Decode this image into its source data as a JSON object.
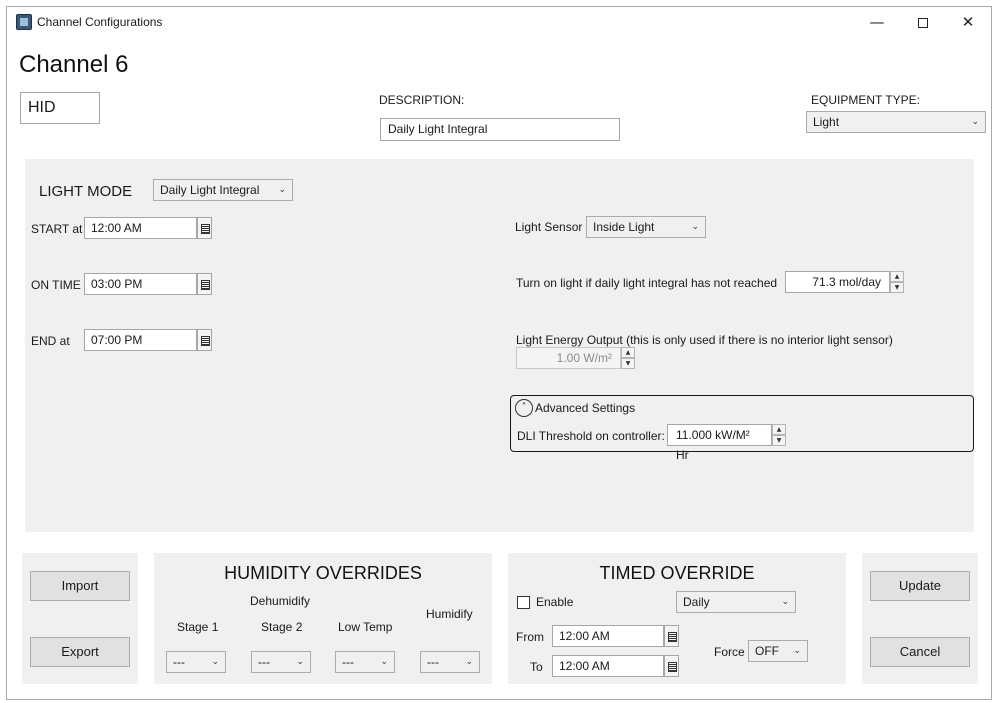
{
  "window": {
    "title": "Channel Configurations"
  },
  "header": {
    "channel_title": "Channel 6",
    "name_value": "HID",
    "description_label": "DESCRIPTION:",
    "description_value": "Daily Light Integral",
    "equipment_type_label": "EQUIPMENT TYPE:",
    "equipment_type_value": "Light"
  },
  "light": {
    "mode_label": "LIGHT MODE",
    "mode_value": "Daily Light Integral",
    "start_label": "START at",
    "start_value": "12:00 AM",
    "on_time_label": "ON TIME",
    "on_time_value": "03:00 PM",
    "end_label": "END at",
    "end_value": "07:00 PM",
    "sensor_label": "Light Sensor",
    "sensor_value": "Inside Light",
    "dli_label": "Turn on light if daily light integral has not reached",
    "dli_value": "71.3 mol/day",
    "energy_label": "Light Energy Output (this is only used if there is no interior light sensor)",
    "energy_value": "1.00 W/m²",
    "advanced_label": "Advanced Settings",
    "threshold_label": "DLI Threshold on controller:",
    "threshold_value": "11.000 kW/M² Hr"
  },
  "actions": {
    "import": "Import",
    "export": "Export",
    "update": "Update",
    "cancel": "Cancel"
  },
  "humidity": {
    "title": "HUMIDITY OVERRIDES",
    "dehumidify_label": "Dehumidify",
    "humidify_label": "Humidify",
    "stage1_label": "Stage 1",
    "stage2_label": "Stage 2",
    "lowtemp_label": "Low Temp",
    "stage1_value": "---",
    "stage2_value": "---",
    "lowtemp_value": "---",
    "humidify_value": "---"
  },
  "timed": {
    "title": "TIMED OVERRIDE",
    "enable_label": "Enable",
    "enable_checked": false,
    "schedule_value": "Daily",
    "from_label": "From",
    "from_value": "12:00 AM",
    "to_label": "To",
    "to_value": "12:00 AM",
    "force_label": "Force",
    "force_value": "OFF"
  }
}
